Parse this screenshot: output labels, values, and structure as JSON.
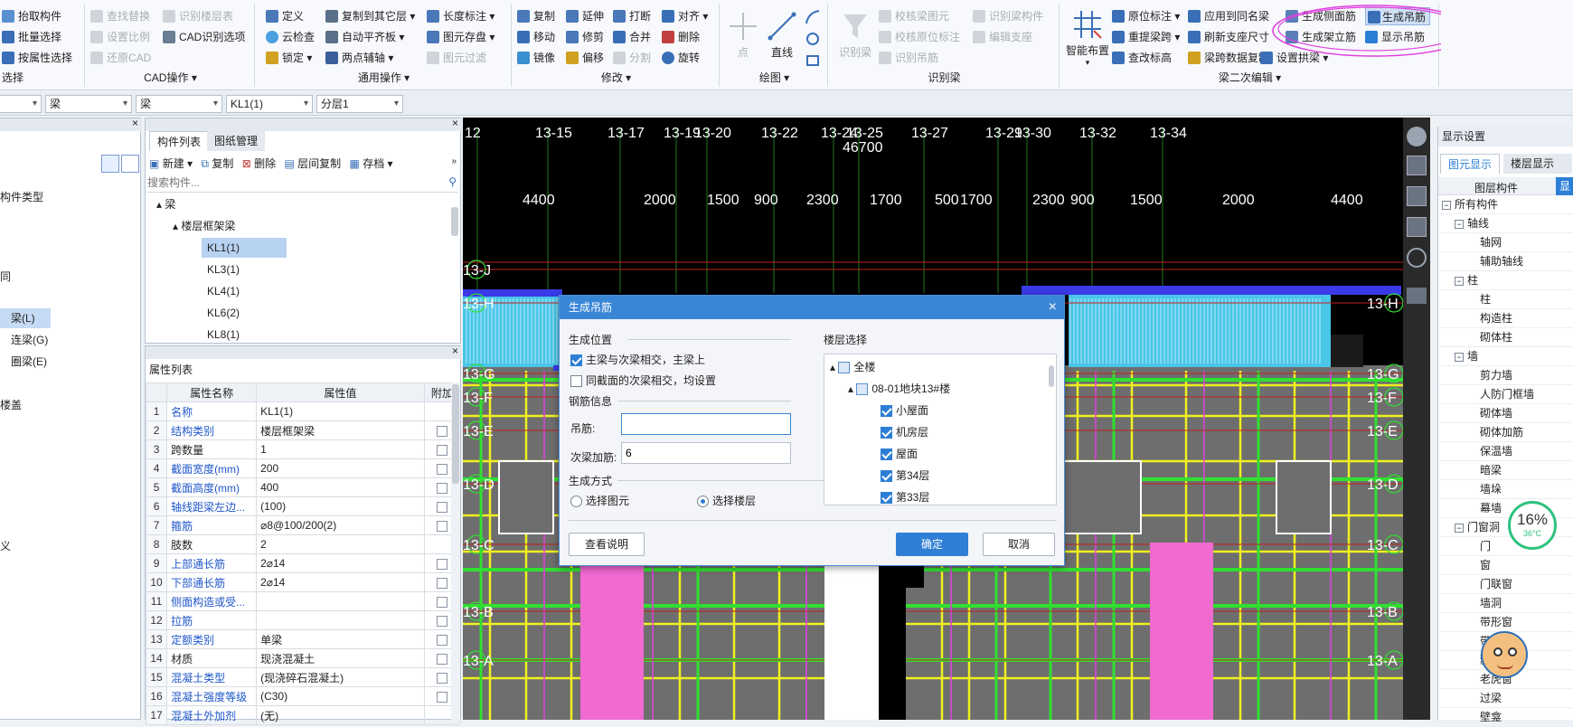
{
  "ribbon": {
    "g1": {
      "items": [
        "抬取构件",
        "批量选择",
        "按属性选择"
      ],
      "title": "选择"
    },
    "g2": {
      "items": [
        "查找替换",
        "设置比例",
        "还原CAD",
        "识别楼层表",
        "CAD识别选项"
      ],
      "title": "CAD操作"
    },
    "g3": {
      "items": [
        "定义",
        "云检查",
        "锁定",
        "复制到其它层",
        "自动平齐板",
        "两点辅轴",
        "长度标注",
        "图元存盘",
        "图元过滤"
      ],
      "title": "通用操作"
    },
    "g4": {
      "items": [
        "复制",
        "移动",
        "镜像",
        "延伸",
        "修剪",
        "偏移",
        "打断",
        "合并",
        "分割",
        "对齐",
        "删除",
        "旋转"
      ],
      "title": "修改"
    },
    "g5": {
      "items": [
        "点",
        "直线"
      ],
      "title": "绘图"
    },
    "g6": {
      "items": [
        "识别梁",
        "校核梁图元",
        "校核原位标注",
        "识别吊筋",
        "识别梁构件",
        "编辑支座"
      ],
      "title": "识别梁"
    },
    "g7": {
      "items": [
        "智能布置",
        "原位标注",
        "重提梁跨",
        "查改标高",
        "应用到同名梁",
        "刷新支座尺寸",
        "梁跨数据复制",
        "设置拱梁",
        "生成侧面筋",
        "生成架立筋",
        "生成吊筋",
        "显示吊筋"
      ],
      "title": "梁二次编辑"
    }
  },
  "toolbar2": {
    "sel0": "",
    "sel1": "梁",
    "sel2": "梁",
    "sel3": "KL1(1)",
    "sel4": "分层1"
  },
  "left_nav": {
    "items": [
      "构件类型",
      "梁(L)",
      "连梁(G)",
      "圈梁(E)"
    ],
    "frag1": "同",
    "frag2": "楼盖",
    "frag3": "义"
  },
  "comp_list": {
    "tabs": [
      "构件列表",
      "图纸管理"
    ],
    "tools": [
      "新建",
      "复制",
      "删除",
      "层间复制",
      "存档"
    ],
    "search_placeholder": "搜索构件...",
    "root": "梁",
    "group": "楼层框架梁",
    "items": [
      "KL1(1)",
      "KL3(1)",
      "KL4(1)",
      "KL6(2)",
      "KL8(1)"
    ]
  },
  "props": {
    "title": "属性列表",
    "headers": [
      "属性名称",
      "属性值",
      "附加"
    ],
    "rows": [
      {
        "i": "1",
        "name": "名称",
        "value": "KL1(1)",
        "chk": false
      },
      {
        "i": "2",
        "name": "结构类别",
        "value": "楼层框架梁",
        "chk": true
      },
      {
        "i": "3",
        "name": "跨数量",
        "value": "1",
        "chk": true
      },
      {
        "i": "4",
        "name": "截面宽度(mm)",
        "value": "200",
        "chk": true
      },
      {
        "i": "5",
        "name": "截面高度(mm)",
        "value": "400",
        "chk": true
      },
      {
        "i": "6",
        "name": "轴线距梁左边...",
        "value": "(100)",
        "chk": true
      },
      {
        "i": "7",
        "name": "箍筋",
        "value": "⌀8@100/200(2)",
        "chk": true
      },
      {
        "i": "8",
        "name": "肢数",
        "value": "2",
        "chk": false
      },
      {
        "i": "9",
        "name": "上部通长筋",
        "value": "2⌀14",
        "chk": true
      },
      {
        "i": "10",
        "name": "下部通长筋",
        "value": "2⌀14",
        "chk": true
      },
      {
        "i": "11",
        "name": "侧面构造或受...",
        "value": "",
        "chk": true
      },
      {
        "i": "12",
        "name": "拉筋",
        "value": "",
        "chk": true
      },
      {
        "i": "13",
        "name": "定额类别",
        "value": "单梁",
        "chk": true
      },
      {
        "i": "14",
        "name": "材质",
        "value": "现浇混凝土",
        "chk": true
      },
      {
        "i": "15",
        "name": "混凝土类型",
        "value": "(现浇碎石混凝土)",
        "chk": true
      },
      {
        "i": "16",
        "name": "混凝土强度等级",
        "value": "(C30)",
        "chk": true
      },
      {
        "i": "17",
        "name": "混凝土外加剂",
        "value": "(无)",
        "chk": false
      }
    ]
  },
  "cad": {
    "axes_top": [
      "12",
      "13-15",
      "13-17",
      "13-19",
      "13-20",
      "13-22",
      "13-24",
      "13-25",
      "13-27",
      "13-29",
      "13-30",
      "13-32",
      "13-34"
    ],
    "total": "46700",
    "dims": [
      "4400",
      "2000",
      "1500",
      "900",
      "2300",
      "1700",
      "500",
      "1700",
      "2300",
      "900",
      "1500",
      "2000",
      "4400"
    ],
    "axes_left": [
      "13-J",
      "13-H",
      "13-G",
      "13-F",
      "13-E",
      "13-D",
      "13-C",
      "13-B",
      "13-A"
    ],
    "axes_right": [
      "13-H",
      "13-G",
      "13-F",
      "13-E",
      "13-D",
      "13-C",
      "13-B",
      "13-A"
    ]
  },
  "dialog": {
    "title": "生成吊筋",
    "pos_title": "生成位置",
    "opt1": "主梁与次梁相交，主梁上",
    "opt2": "同截面的次梁相交，均设置",
    "rebar_title": "钢筋信息",
    "hang_label": "吊筋:",
    "hang_value": "",
    "add_label": "次梁加筋:",
    "add_value": "6",
    "method_title": "生成方式",
    "method1": "选择图元",
    "method2": "选择楼层",
    "floor_title": "楼层选择",
    "floors": [
      "全楼",
      "08-01地块13#楼",
      "小屋面",
      "机房层",
      "屋面",
      "第34层",
      "第33层"
    ],
    "help_btn": "查看说明",
    "ok_btn": "确定",
    "cancel_btn": "取消"
  },
  "right_panel": {
    "title": "显示设置",
    "tabs": [
      "图元显示",
      "楼层显示"
    ],
    "col_header": "图层构件",
    "col_header2": "显",
    "items": [
      {
        "label": "所有构件",
        "level": 0,
        "exp": "-"
      },
      {
        "label": "轴线",
        "level": 1,
        "exp": "-"
      },
      {
        "label": "轴网",
        "level": 2,
        "exp": ""
      },
      {
        "label": "辅助轴线",
        "level": 2,
        "exp": ""
      },
      {
        "label": "柱",
        "level": 1,
        "exp": "-"
      },
      {
        "label": "柱",
        "level": 2,
        "exp": ""
      },
      {
        "label": "构造柱",
        "level": 2,
        "exp": ""
      },
      {
        "label": "砌体柱",
        "level": 2,
        "exp": ""
      },
      {
        "label": "墙",
        "level": 1,
        "exp": "-"
      },
      {
        "label": "剪力墙",
        "level": 2,
        "exp": ""
      },
      {
        "label": "人防门框墙",
        "level": 2,
        "exp": ""
      },
      {
        "label": "砌体墙",
        "level": 2,
        "exp": ""
      },
      {
        "label": "砌体加筋",
        "level": 2,
        "exp": ""
      },
      {
        "label": "保温墙",
        "level": 2,
        "exp": ""
      },
      {
        "label": "暗梁",
        "level": 2,
        "exp": ""
      },
      {
        "label": "墙垛",
        "level": 2,
        "exp": ""
      },
      {
        "label": "幕墙",
        "level": 2,
        "exp": ""
      },
      {
        "label": "门窗洞",
        "level": 1,
        "exp": "-"
      },
      {
        "label": "门",
        "level": 2,
        "exp": ""
      },
      {
        "label": "窗",
        "level": 2,
        "exp": ""
      },
      {
        "label": "门联窗",
        "level": 2,
        "exp": ""
      },
      {
        "label": "墙洞",
        "level": 2,
        "exp": ""
      },
      {
        "label": "带形窗",
        "level": 2,
        "exp": ""
      },
      {
        "label": "带",
        "level": 2,
        "exp": ""
      },
      {
        "label": "飘",
        "level": 2,
        "exp": ""
      },
      {
        "label": "老虎窗",
        "level": 2,
        "exp": ""
      },
      {
        "label": "过梁",
        "level": 2,
        "exp": ""
      },
      {
        "label": "壁龛",
        "level": 2,
        "exp": ""
      }
    ]
  },
  "widget": {
    "percent": "16%",
    "temp": "36°C"
  },
  "colors": {
    "accent": "#2f7fd6",
    "cad_bg": "#000000",
    "highlight": "#e040e0"
  }
}
